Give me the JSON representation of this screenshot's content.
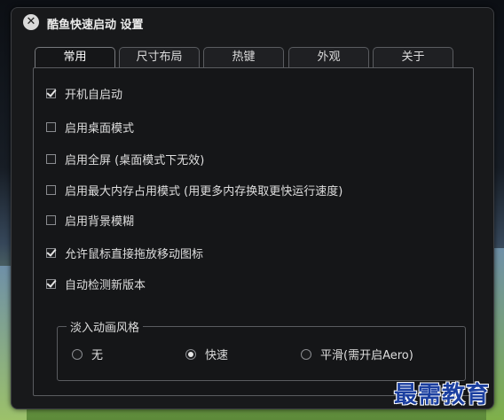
{
  "window": {
    "title": "酷鱼快速启动 设置",
    "close_glyph": "✕"
  },
  "tabs": [
    {
      "label": "常用",
      "active": true
    },
    {
      "label": "尺寸布局",
      "active": false
    },
    {
      "label": "热键",
      "active": false
    },
    {
      "label": "外观",
      "active": false
    },
    {
      "label": "关于",
      "active": false
    }
  ],
  "options": [
    {
      "label": "开机自启动",
      "checked": true
    },
    {
      "label": "启用桌面模式",
      "checked": false
    },
    {
      "label": "启用全屏 (桌面模式下无效)",
      "checked": false
    },
    {
      "label": "启用最大内存占用模式 (用更多内存换取更快运行速度)",
      "checked": false
    },
    {
      "label": "启用背景模糊",
      "checked": false
    },
    {
      "label": "允许鼠标直接拖放移动图标",
      "checked": true
    },
    {
      "label": "自动检测新版本",
      "checked": true
    }
  ],
  "animation_group": {
    "title": "淡入动画风格",
    "options": [
      {
        "label": "无",
        "selected": false
      },
      {
        "label": "快速",
        "selected": true
      },
      {
        "label": "平滑(需开启Aero)",
        "selected": false
      }
    ]
  },
  "watermark": "最需教育"
}
